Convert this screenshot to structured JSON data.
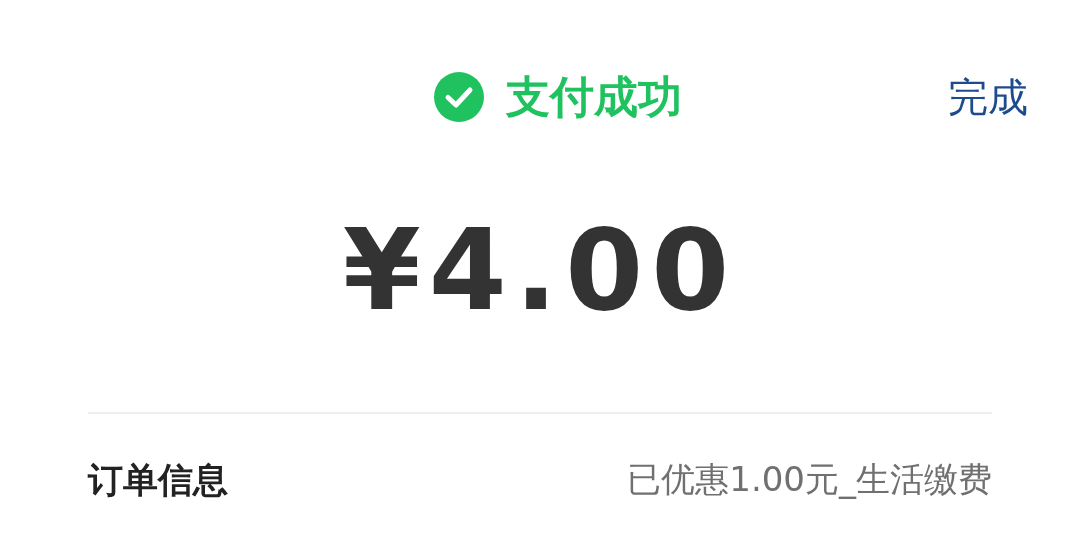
{
  "header": {
    "title": "支付成功",
    "done": "完成"
  },
  "amount": "¥4.00",
  "order": {
    "label": "订单信息",
    "value": "已优惠1.00元_生活缴费"
  }
}
